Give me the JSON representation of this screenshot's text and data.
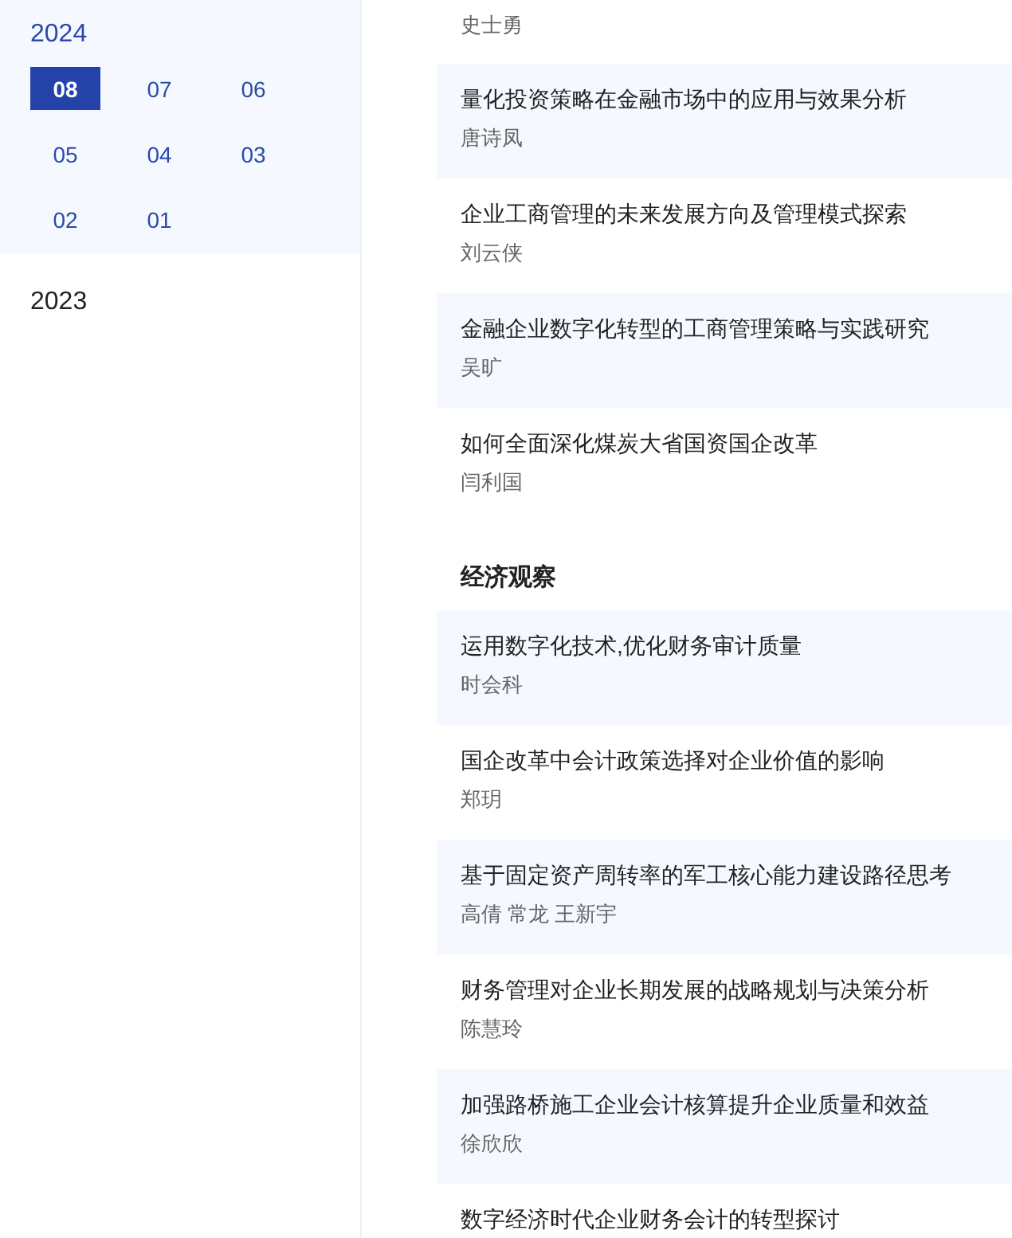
{
  "years": [
    {
      "year": "2024",
      "expanded": true,
      "months": [
        {
          "label": "08",
          "selected": true
        },
        {
          "label": "07",
          "selected": false
        },
        {
          "label": "06",
          "selected": false
        },
        {
          "label": "05",
          "selected": false
        },
        {
          "label": "04",
          "selected": false
        },
        {
          "label": "03",
          "selected": false
        },
        {
          "label": "02",
          "selected": false
        },
        {
          "label": "01",
          "selected": false
        }
      ]
    },
    {
      "year": "2023",
      "expanded": false
    }
  ],
  "sections": [
    {
      "articles": [
        {
          "authors": "史士勇"
        },
        {
          "title": "量化投资策略在金融市场中的应用与效果分析",
          "authors": "唐诗凤"
        },
        {
          "title": "企业工商管理的未来发展方向及管理模式探索",
          "authors": "刘云侠"
        },
        {
          "title": "金融企业数字化转型的工商管理策略与实践研究",
          "authors": "吴旷"
        },
        {
          "title": "如何全面深化煤炭大省国资国企改革",
          "authors": "闫利国"
        }
      ]
    },
    {
      "heading": "经济观察",
      "articles": [
        {
          "title": "运用数字化技术,优化财务审计质量",
          "authors": "时会科"
        },
        {
          "title": "国企改革中会计政策选择对企业价值的影响",
          "authors": "郑玥"
        },
        {
          "title": "基于固定资产周转率的军工核心能力建设路径思考",
          "authors": "高倩 常龙 王新宇"
        },
        {
          "title": "财务管理对企业长期发展的战略规划与决策分析",
          "authors": "陈慧玲"
        },
        {
          "title": "加强路桥施工企业会计核算提升企业质量和效益",
          "authors": "徐欣欣"
        },
        {
          "title": "数字经济时代企业财务会计的转型探讨"
        }
      ]
    }
  ]
}
